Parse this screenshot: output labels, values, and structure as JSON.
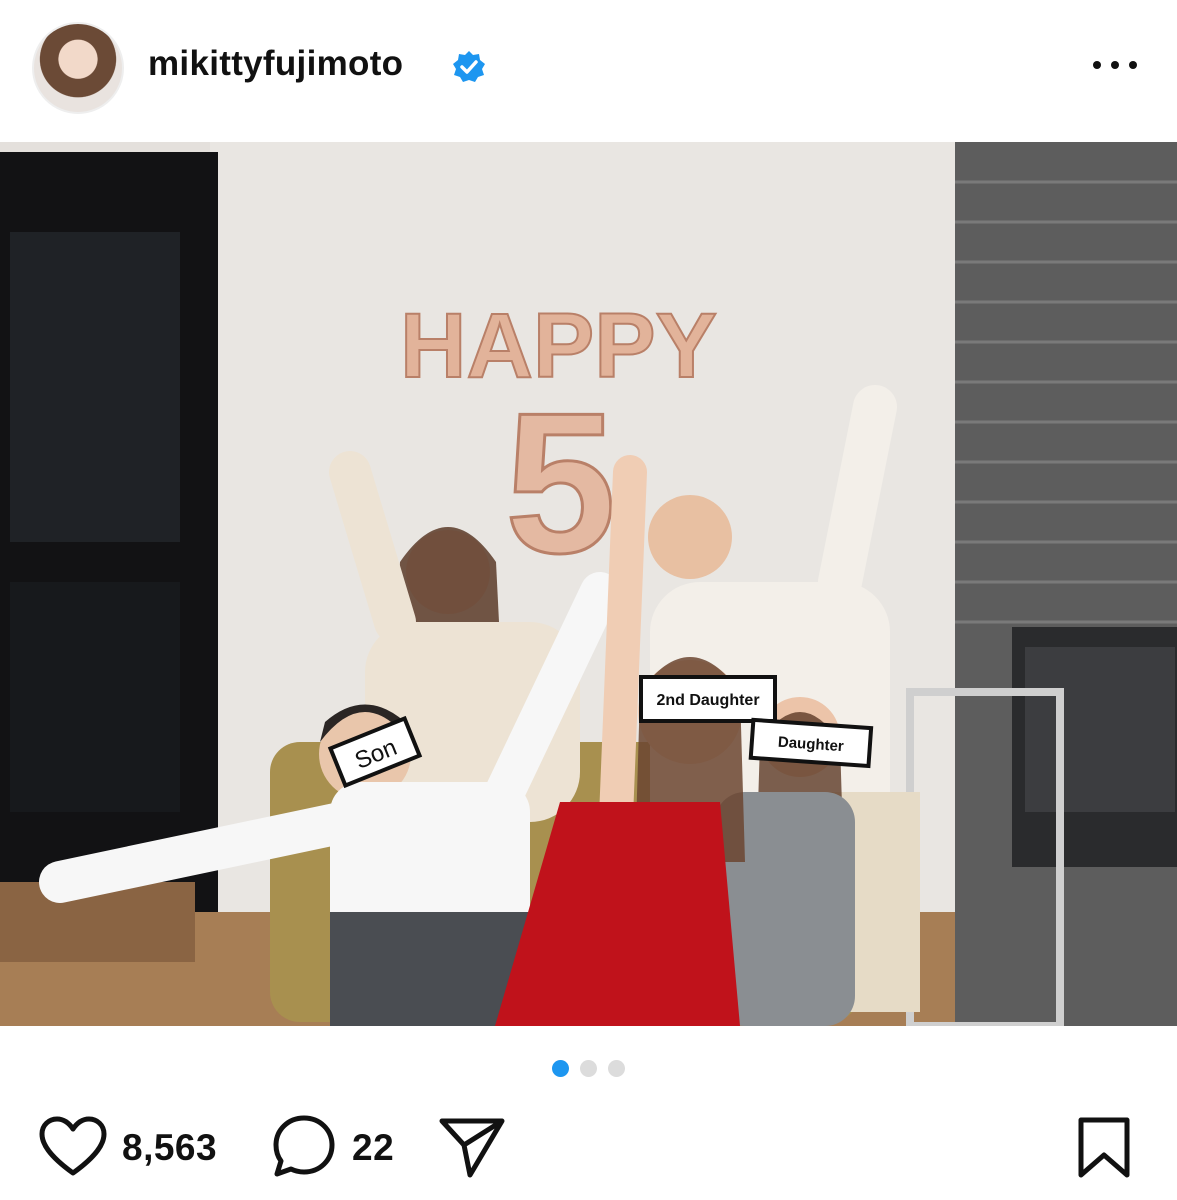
{
  "header": {
    "username": "mikittyfujimoto",
    "verified_icon": "verified-badge-icon",
    "more_icon": "more-options-icon"
  },
  "photo": {
    "balloon_top": "HAPPY",
    "balloon_number": "5",
    "labels": {
      "son": "Son",
      "second_daughter": "2nd Daughter",
      "daughter": "Daughter"
    }
  },
  "carousel": {
    "total": 3,
    "active": 1,
    "active_color": "#1d96f0"
  },
  "actions": {
    "likes": "8,563",
    "comments": "22",
    "like_icon": "heart-icon",
    "comment_icon": "comment-icon",
    "share_icon": "share-icon",
    "save_icon": "bookmark-icon"
  }
}
